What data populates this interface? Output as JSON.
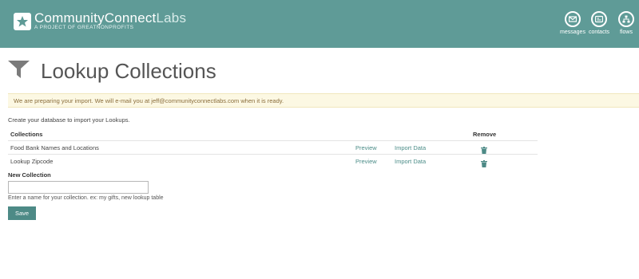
{
  "header": {
    "brand_bold": "Community",
    "brand_connect": "Connect",
    "brand_thin": "Labs",
    "tagline": "A PROJECT OF GREATNONPROFITS",
    "nav": [
      {
        "label": "messages",
        "icon": "envelope-icon"
      },
      {
        "label": "contacts",
        "icon": "id-card-icon"
      },
      {
        "label": "flows",
        "icon": "flow-tree-icon"
      }
    ]
  },
  "page": {
    "title": "Lookup Collections",
    "alert": "We are preparing your import. We will e-mail you at jeff@communityconnectlabs.com when it is ready.",
    "intro": "Create your database to import your Lookups."
  },
  "table": {
    "headers": {
      "collections": "Collections",
      "remove": "Remove"
    },
    "rows": [
      {
        "name": "Food Bank Names and Locations",
        "preview": "Preview",
        "import": "Import Data"
      },
      {
        "name": "Lookup Zipcode",
        "preview": "Preview",
        "import": "Import Data"
      }
    ]
  },
  "form": {
    "label": "New Collection",
    "value": "",
    "placeholder": "",
    "help": "Enter a name for your collection. ex: my gifts, new lookup table",
    "save": "Save"
  },
  "colors": {
    "header_bg": "#5f9b97",
    "accent": "#4d8a86",
    "link": "#4c8d88",
    "alert_bg": "#fcf8e3",
    "alert_text": "#8a6d3b"
  }
}
